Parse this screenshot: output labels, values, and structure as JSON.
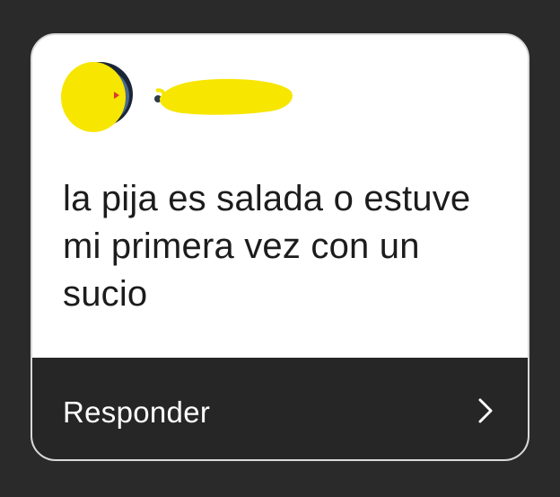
{
  "card": {
    "message": "la pija es salada o estuve mi primera vez con un sucio",
    "reply_label": "Responder",
    "avatar_icon": "avatar-redacted",
    "chevron_icon": "chevron-right-icon",
    "redaction_color": "#f7e600"
  }
}
